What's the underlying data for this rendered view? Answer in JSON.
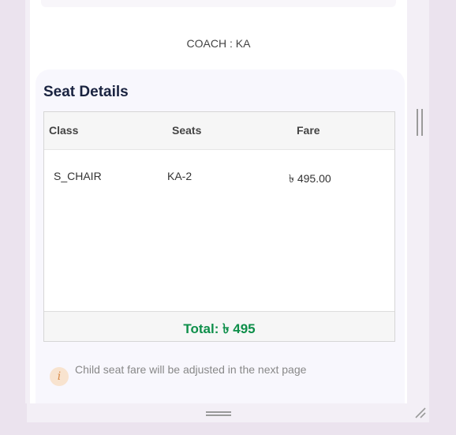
{
  "coach": {
    "label": "COACH : KA"
  },
  "seat_details": {
    "title": "Seat Details",
    "columns": [
      "Class",
      "Seats",
      "Fare"
    ],
    "rows": [
      {
        "class": "S_CHAIR",
        "seats": "KA-2",
        "fare": "৳ 495.00"
      }
    ],
    "total": "Total: ৳ 495"
  },
  "notice": {
    "icon": "info-icon",
    "icon_glyph": "i",
    "text": "Child seat fare will be adjusted in the next page"
  },
  "colors": {
    "total_green": "#0e8f4a",
    "title_navy": "#1a2340",
    "info_orange": "#d98a47"
  }
}
